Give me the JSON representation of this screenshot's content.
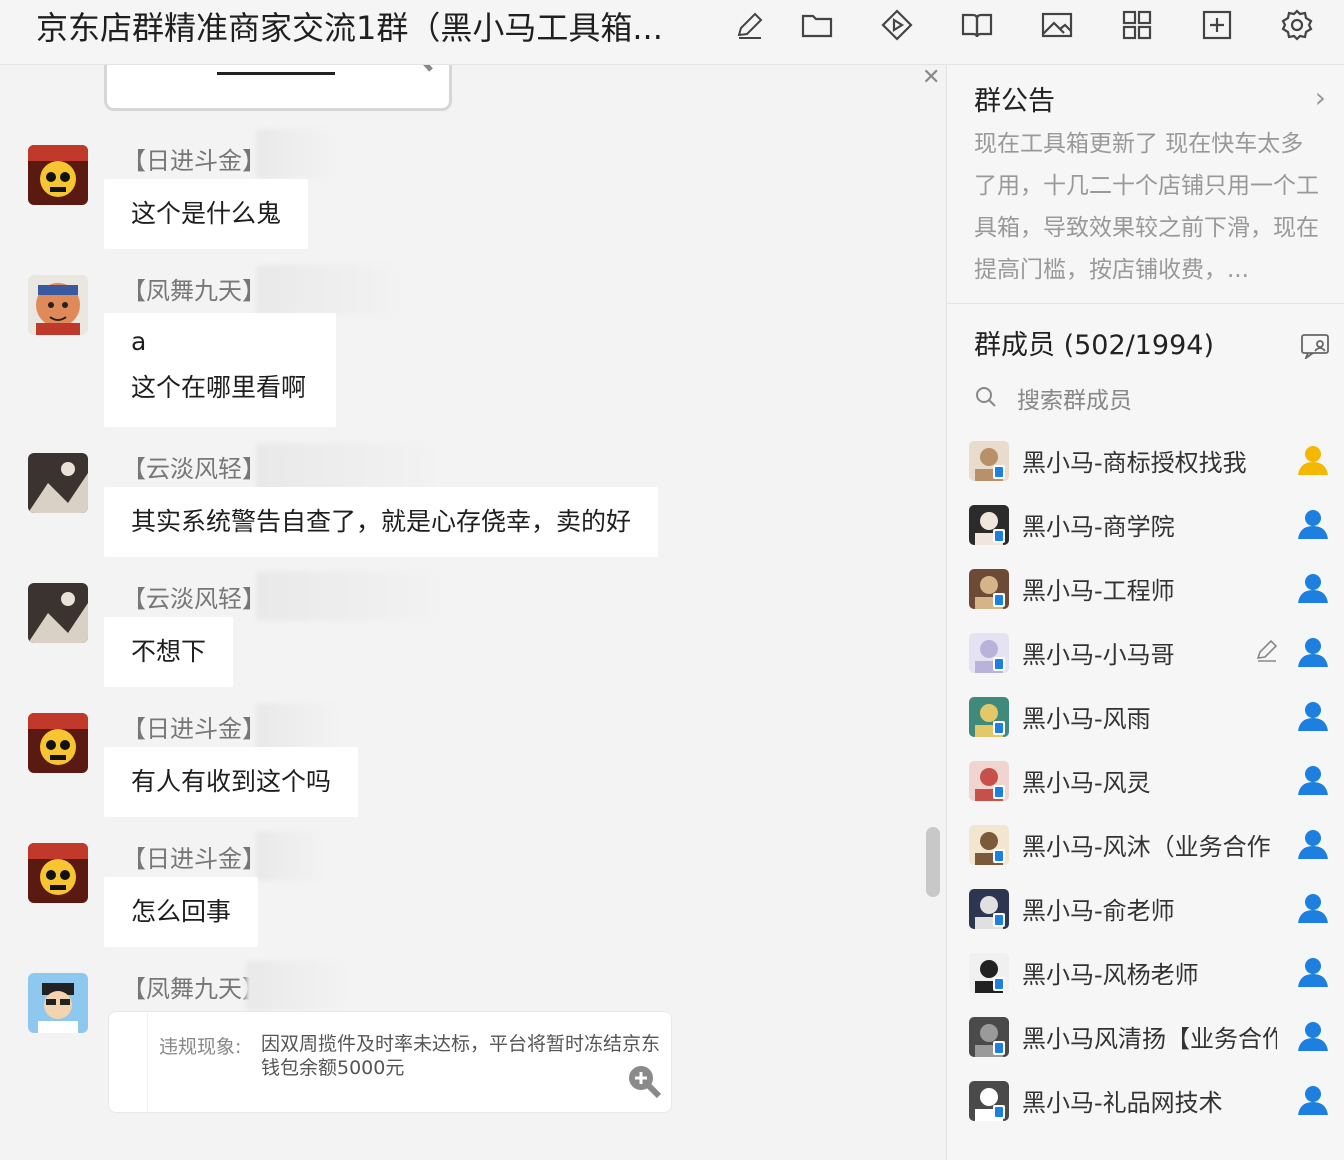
{
  "header": {
    "title": "京东店群精准商家交流1群（黑小马工具箱...",
    "icons": [
      "edit-icon",
      "folder-icon",
      "play-icon",
      "book-icon",
      "image-icon",
      "grid-icon",
      "add-window-icon",
      "settings-icon"
    ]
  },
  "chat": {
    "messages": [
      {
        "sender": "【日进斗金】",
        "text": "这个是什么鬼"
      },
      {
        "sender": "【凤舞九天】",
        "line1": "a",
        "line2": "这个在哪里看啊"
      },
      {
        "sender": "【云淡风轻】",
        "text": "其实系统警告自查了，就是心存侥幸，卖的好"
      },
      {
        "sender": "【云淡风轻】",
        "text": "不想下"
      },
      {
        "sender": "【日进斗金】",
        "text": "有人有收到这个吗"
      },
      {
        "sender": "【日进斗金】",
        "text": "怎么回事"
      },
      {
        "sender": "【凤舞九天】",
        "card_label": "违规现象:",
        "card_text": "因双周揽件及时率未达标，平台将暂时冻结京东钱包余额5000元"
      }
    ]
  },
  "sidebar": {
    "notice_title": "群公告",
    "notice_body": "现在工具箱更新了 现在快车太多了用，十几二十个店铺只用一个工具箱，导致效果较之前下滑，现在提高门槛，按店铺收费，...",
    "members_title": "群成员 (502/1994)",
    "search_placeholder": "搜索群成员",
    "members": [
      {
        "name": "黑小马-商标授权找我",
        "role": "owner"
      },
      {
        "name": "黑小马-商学院",
        "role": "admin"
      },
      {
        "name": "黑小马-工程师",
        "role": "admin"
      },
      {
        "name": "黑小马-小马哥",
        "role": "admin"
      },
      {
        "name": "黑小马-风雨",
        "role": "admin"
      },
      {
        "name": "黑小马-风灵",
        "role": "admin"
      },
      {
        "name": "黑小马-风沐（业务合作",
        "role": "admin"
      },
      {
        "name": "黑小马-俞老师",
        "role": "admin"
      },
      {
        "name": "黑小马-风杨老师",
        "role": "admin"
      },
      {
        "name": "黑小马风清扬【业务合作",
        "role": "admin"
      },
      {
        "name": "黑小马-礼品网技术",
        "role": "admin"
      }
    ],
    "colors": {
      "owner": "#f5b800",
      "admin": "#1d7fe0"
    }
  }
}
